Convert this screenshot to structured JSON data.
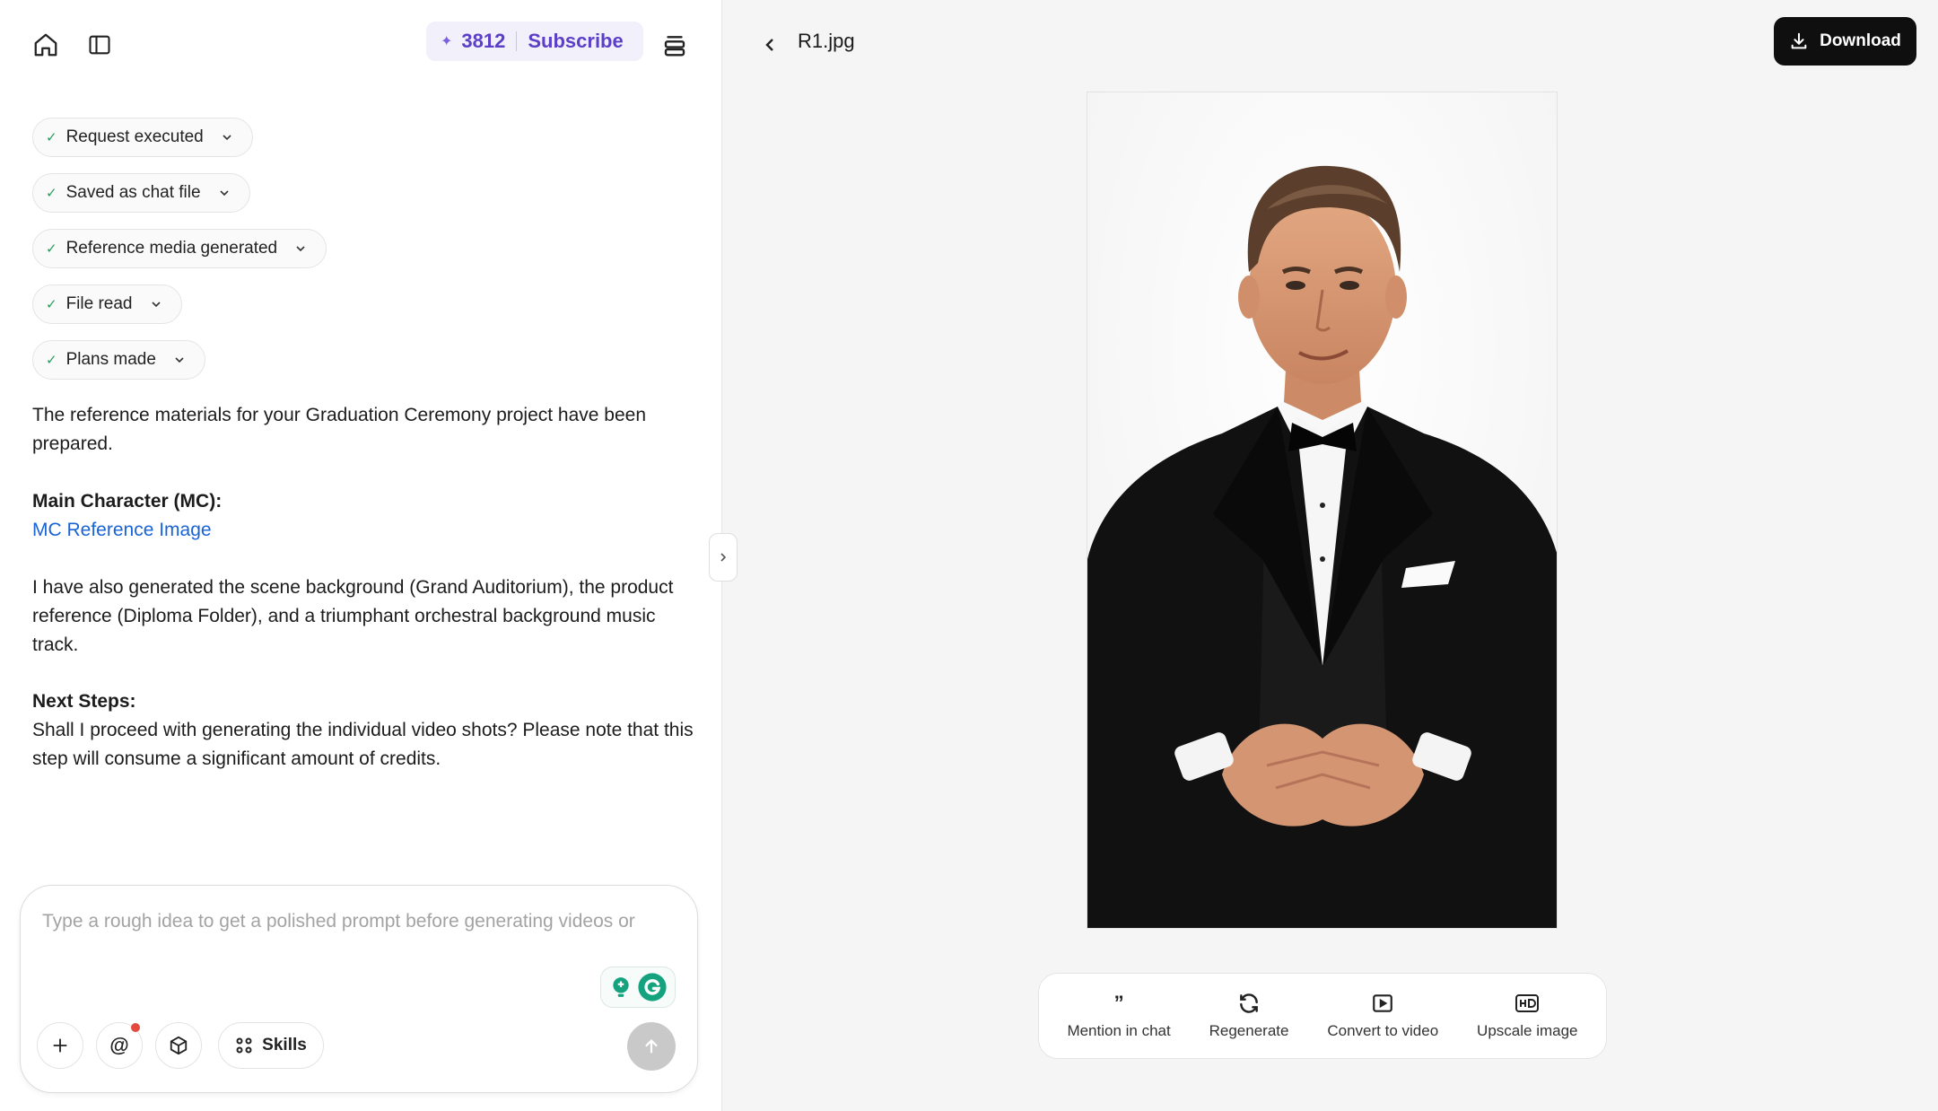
{
  "header": {
    "credits_value": "3812",
    "subscribe_label": "Subscribe",
    "credits_icon": "sparkle-icon"
  },
  "status_chips": [
    {
      "label": "Request executed"
    },
    {
      "label": "Saved as chat file"
    },
    {
      "label": "Reference media generated"
    },
    {
      "label": "File read"
    },
    {
      "label": "Plans made"
    }
  ],
  "message": {
    "intro": "The reference materials for your Graduation Ceremony project have been prepared.",
    "mc_heading": "Main Character (MC):",
    "mc_link": "MC Reference Image",
    "body": "I have also generated the scene background (Grand Auditorium), the product reference (Diploma Folder), and a triumphant orchestral background music track.",
    "next_heading": "Next Steps:",
    "next_body": "Shall I proceed with generating the individual video shots? Please note that this step will consume a significant amount of credits."
  },
  "composer": {
    "placeholder": "Type a rough idea to get a polished prompt before generating videos or",
    "skills_label": "Skills",
    "mention_symbol": "@"
  },
  "viewer": {
    "file_name": "R1.jpg",
    "download_label": "Download",
    "actions": [
      {
        "label": "Mention in chat",
        "icon": "quote-icon"
      },
      {
        "label": "Regenerate",
        "icon": "refresh-icon"
      },
      {
        "label": "Convert to video",
        "icon": "video-icon"
      },
      {
        "label": "Upscale image",
        "icon": "hd-icon"
      }
    ]
  },
  "colors": {
    "accent": "#5b3fc6",
    "link": "#1a63d6",
    "success": "#2a9d5c",
    "download_bg": "#0f0f0f"
  }
}
